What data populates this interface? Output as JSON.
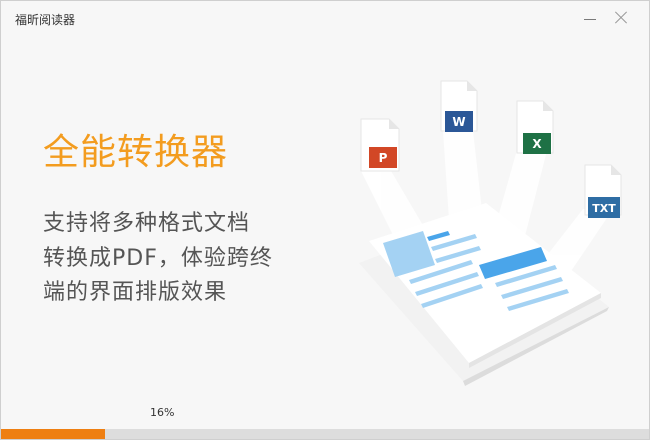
{
  "window": {
    "title": "福昕阅读器"
  },
  "promo": {
    "headline": "全能转换器",
    "description_lines": [
      "支持将多种格式文档",
      "转换成PDF，体验跨终",
      "端的界面排版效果"
    ]
  },
  "file_icons": [
    {
      "label": "P",
      "color": "#d24726",
      "icon": "powerpoint-file-icon"
    },
    {
      "label": "W",
      "color": "#2b5797",
      "icon": "word-file-icon"
    },
    {
      "label": "X",
      "color": "#1e7145",
      "icon": "excel-file-icon"
    },
    {
      "label": "TXT",
      "color": "#2e6da4",
      "icon": "txt-file-icon"
    }
  ],
  "progress": {
    "percent_label": "16%",
    "value": 0.16,
    "color": "#ee7f12"
  }
}
